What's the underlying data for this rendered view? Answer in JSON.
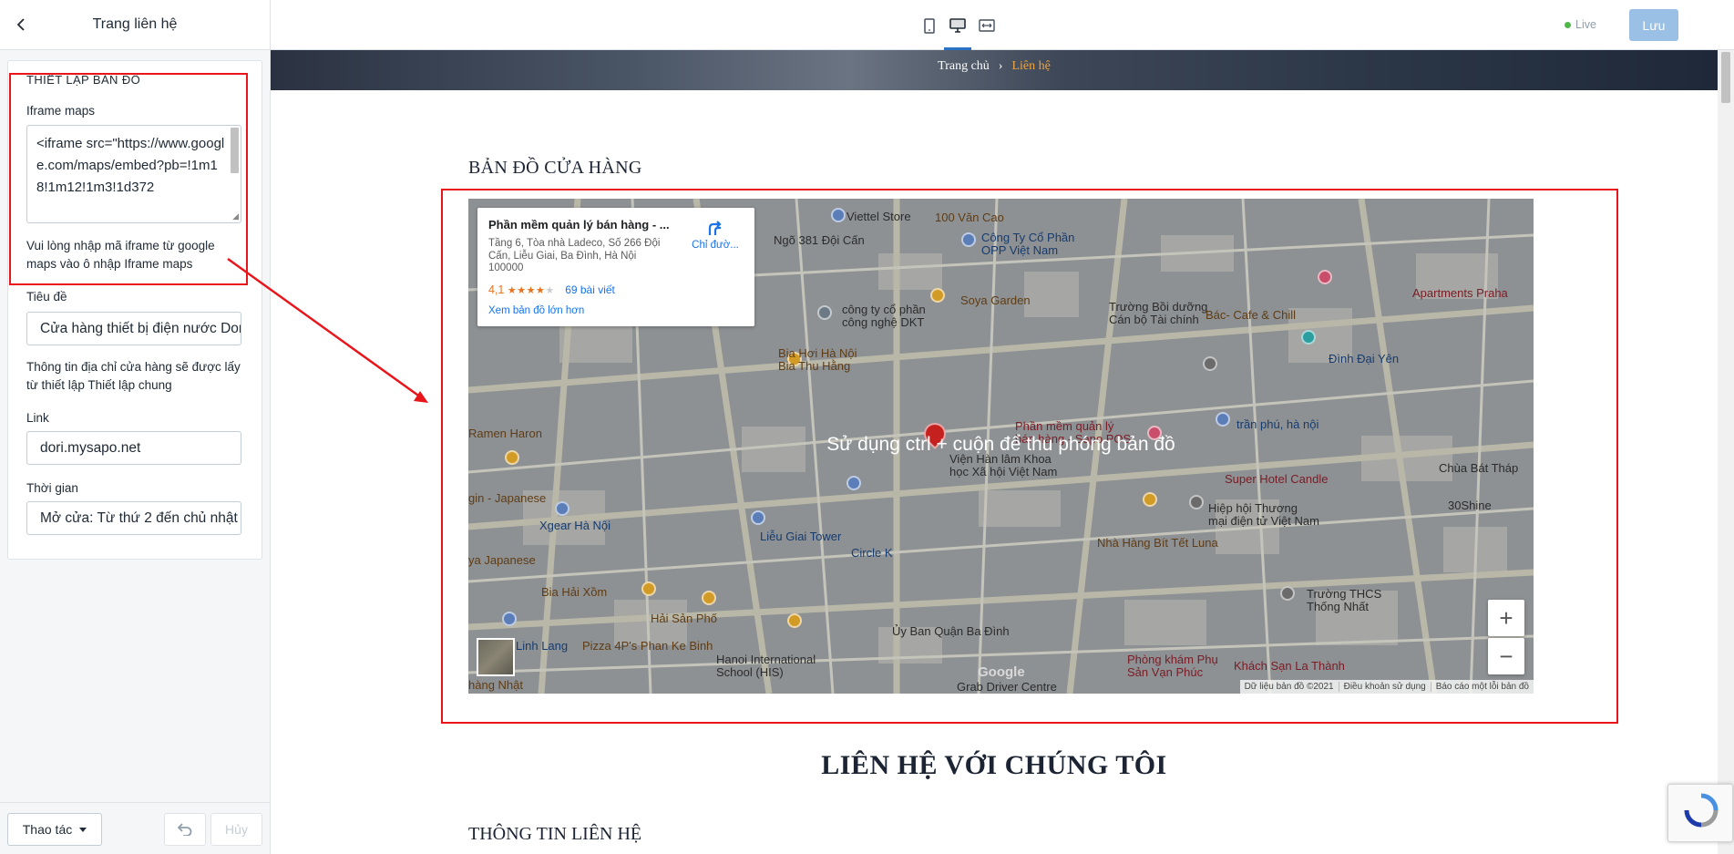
{
  "left_panel": {
    "title": "Trang liên hệ",
    "section_title": "THIẾT LẬP BẢN ĐỒ",
    "iframe_label": "Iframe maps",
    "iframe_value": "<iframe src=\"https://www.google.com/maps/embed?pb=!1m18!1m12!1m3!1d372",
    "iframe_help": "Vui lòng nhập mã iframe từ google maps vào ô nhập Iframe maps",
    "title_label": "Tiêu đề",
    "title_value": "Cửa hàng thiết bị điện nước Dori",
    "address_help": "Thông tin địa chỉ cửa hàng sẽ được lấy từ thiết lập Thiết lập chung",
    "link_label": "Link",
    "link_value": "dori.mysapo.net",
    "time_label": "Thời gian",
    "time_value": "Mở cửa: Từ thứ 2 đến chủ nhật",
    "footer": {
      "actions_label": "Thao tác",
      "cancel_label": "Hủy"
    }
  },
  "topbar": {
    "live_label": "Live",
    "save_label": "Lưu",
    "devices": [
      "mobile-icon",
      "desktop-icon",
      "fullwidth-icon"
    ],
    "active_device": "desktop"
  },
  "preview": {
    "breadcrumb_home": "Trang chủ",
    "breadcrumb_separator": "›",
    "breadcrumb_current": "Liên hệ",
    "store_map_title": "BẢN ĐỒ CỬA HÀNG",
    "map": {
      "overlay_text": "Sử dụng ctrl + cuộn để thu phóng bản đồ",
      "place_name": "Phần mềm quản lý bán hàng - ...",
      "place_address": "Tầng 6, Tòa nhà Ladeco, Số 266 Đội Cấn, Liễu Giai, Ba Đình, Hà Nội 100000",
      "rating": "4,1",
      "stars": 4.1,
      "reviews": "69 bài viết",
      "bigger_map": "Xem bản đồ lớn hơn",
      "directions": "Chỉ đườ...",
      "zoom_in": "+",
      "zoom_out": "−",
      "google": "Google",
      "attribution": [
        "Dữ liệu bản đồ ©2021",
        "Điều khoản sử dụng",
        "Báo cáo một lỗi bản đồ"
      ],
      "labels": {
        "viettel": "Viettel Store",
        "van_cao": "100 Văn Cao",
        "ngo381": "Ngõ 381 Đội Cấn",
        "opp": "Công Ty Cổ Phần\nOPP Việt Nam",
        "soya": "Soya Garden",
        "dkt": "công ty cổ phần\ncông nghệ DKT",
        "boiduong": "Trường Bồi dưỡng\nCán bộ Tài chính",
        "bac_cafe": "Bác- Cafe & Chill",
        "apartments": "Apartments Praha",
        "dinh_dai_yen": "Đình Đại Yên",
        "bia_hn": "Bia Hơi Hà Nội\nBia Thu Hằng",
        "sapo_pos": "Phần mềm quản lý\nbán hàng - Sapo POS",
        "tran_phu": "trần phú, hà nội",
        "vien_han_lam": "Viện Hàn lâm Khoa\nhọc Xã hội Việt Nam",
        "super_hotel": "Super Hotel Candle",
        "chua_bat_thap": "Chùa Bát Tháp",
        "ramen": "Ramen Haron",
        "japanese": "gin - Japanese",
        "xgear": "Xgear Hà Nội",
        "lieu_giai_tower": "Liễu Giai Tower",
        "hiep_hoi": "Hiệp hội Thương\nmại điện tử Việt Nam",
        "30shine": "30Shine",
        "bit_tet": "Nhà Hàng Bít Tết Luna",
        "circle_k": "Circle K",
        "ya_japanese": "ya Japanese",
        "bia_hai_xom": "Bia Hải Xồm",
        "hai_san_pho": "Hải Sản Phố",
        "thcs": "Trường THCS\nThống Nhất",
        "linh_lang": "Linh Lang",
        "pizza": "Pizza 4P's Phan Ke Binh",
        "ubnd": "Ủy Ban Quận Ba Đình",
        "his": "Hanoi International\nSchool (HIS)",
        "phong_kham": "Phòng khám Phụ\nSản Vạn Phúc",
        "khach_san": "Khách Sạn La Thành",
        "grab": "Grab Driver Centre",
        "hang_nhat": "hàng Nhật"
      }
    },
    "contact_title": "LIÊN HỆ VỚI CHÚNG TÔI",
    "contact_info_title": "THÔNG TIN LIÊN HỆ"
  },
  "colors": {
    "annotation_red": "#e8151b",
    "primary_blue": "#2a72c6",
    "save_disabled": "#9bc0e5",
    "live_green": "#4cb847",
    "breadcrumb_accent": "#f0a33e"
  }
}
